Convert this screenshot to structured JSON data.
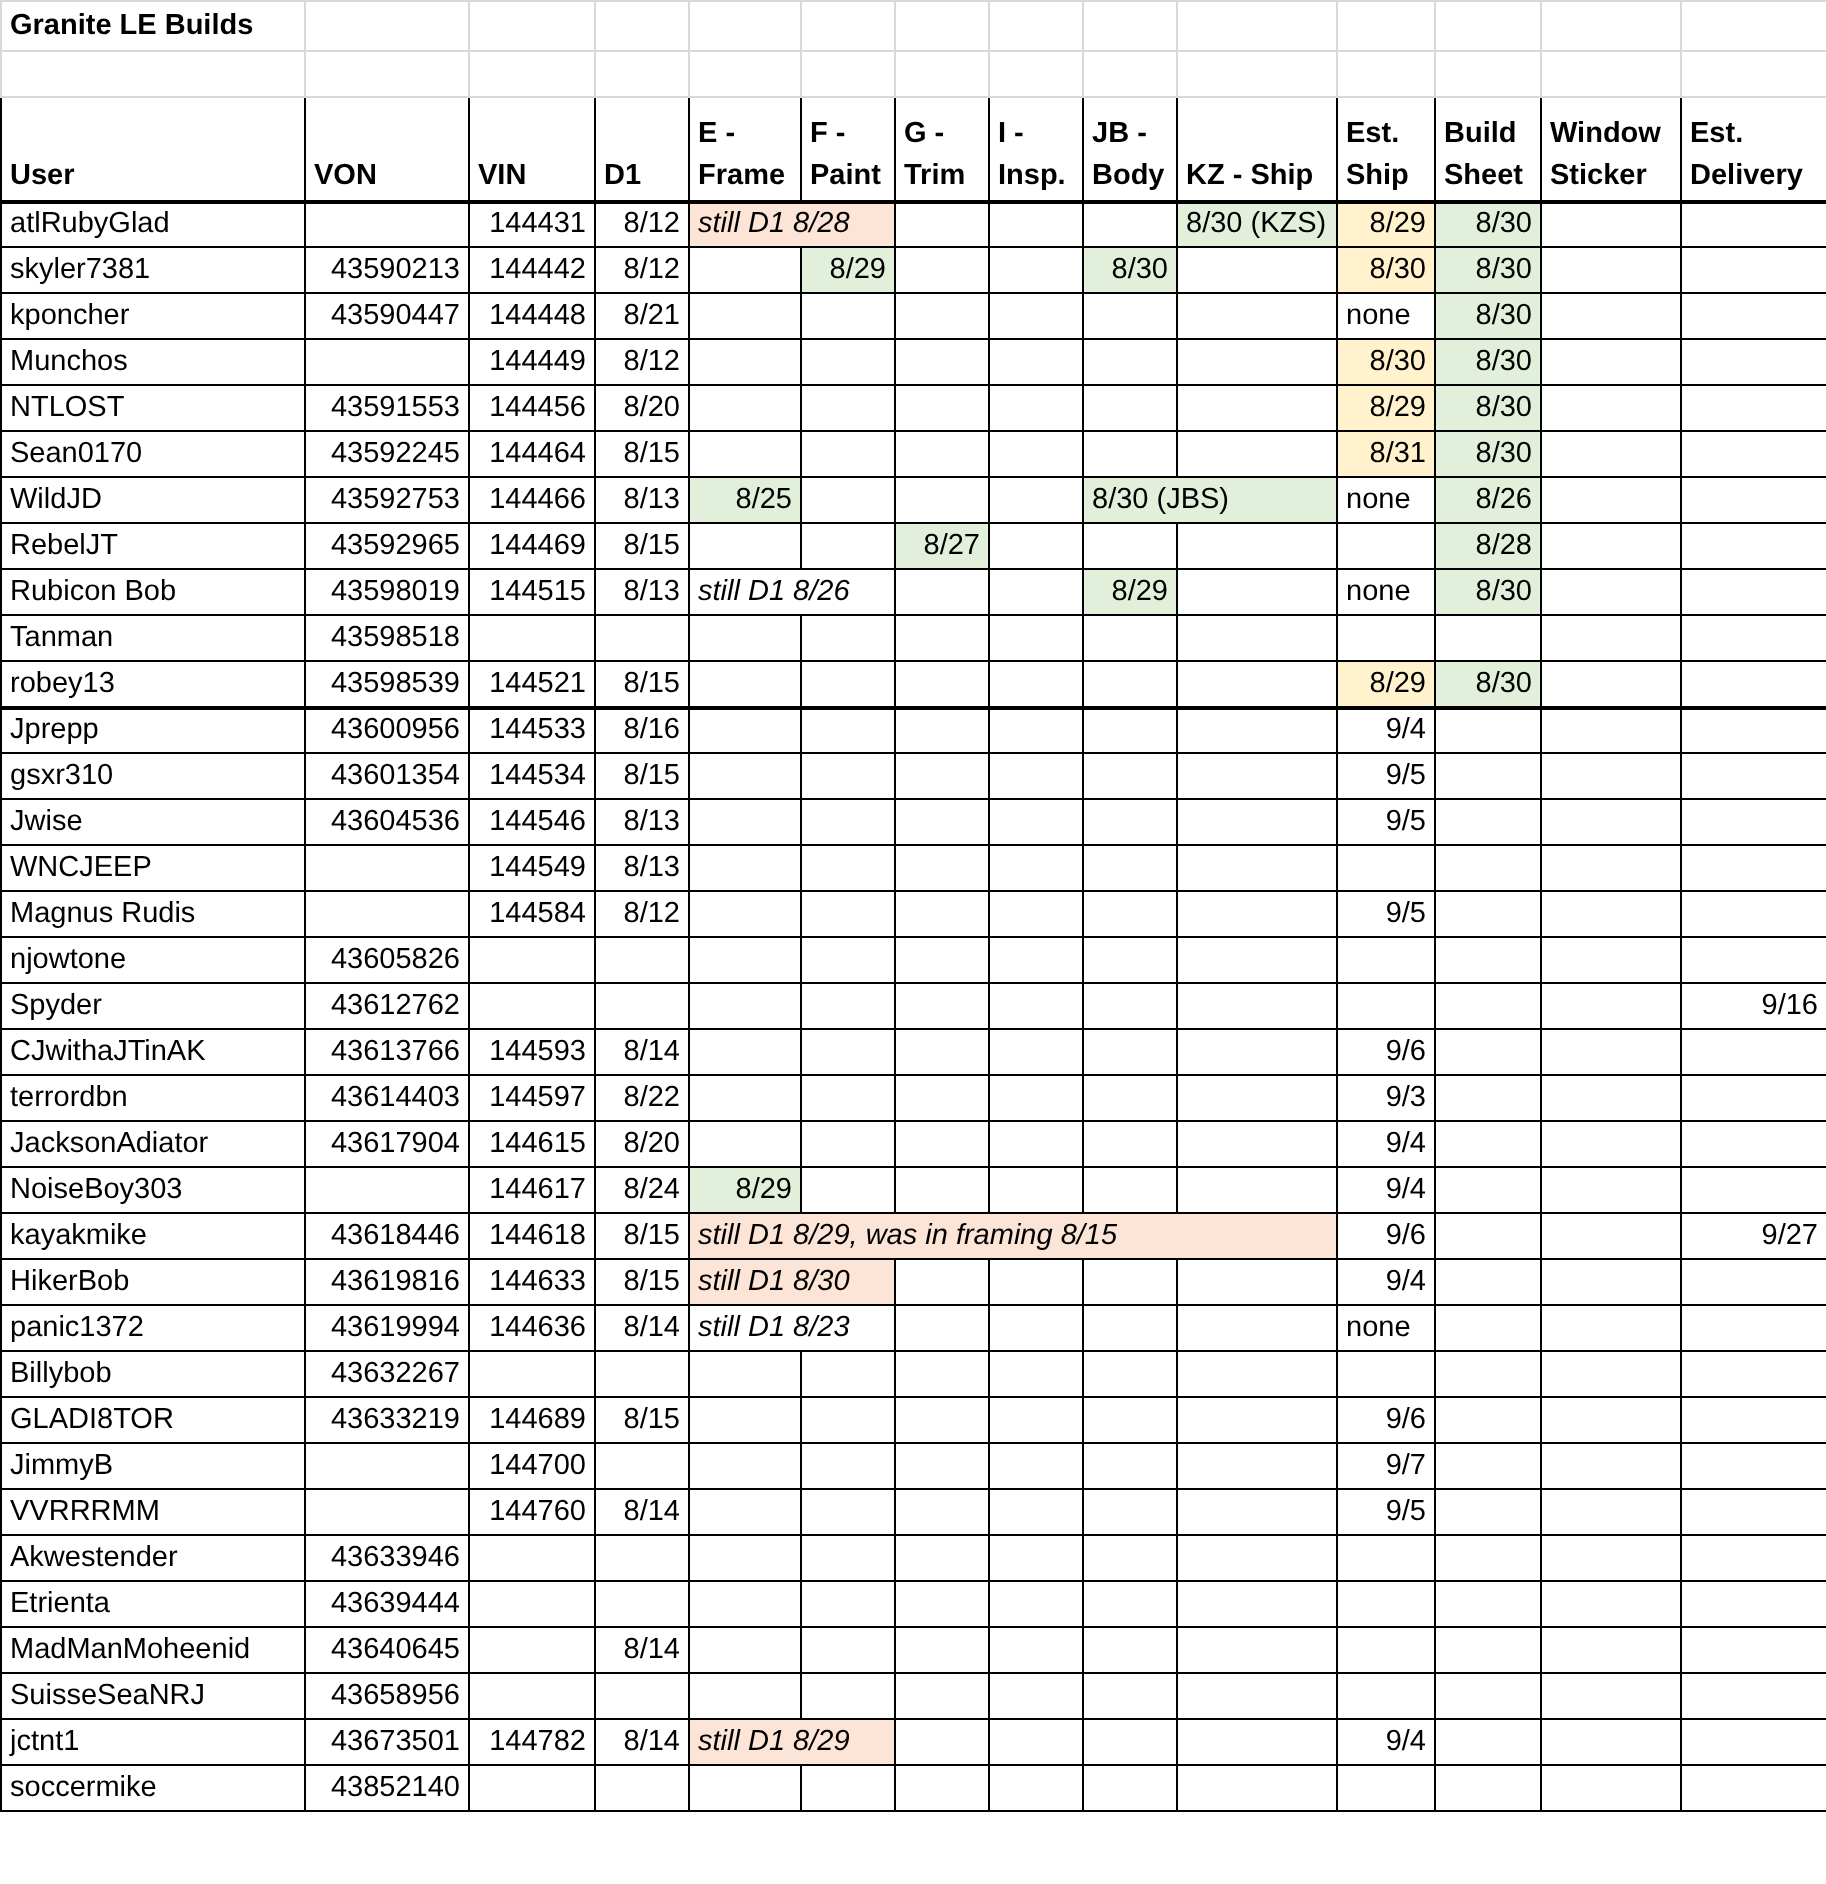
{
  "title": "Granite LE Builds",
  "columns": [
    "User",
    "VON",
    "VIN",
    "D1",
    "E - Frame",
    "F - Paint",
    "G - Trim",
    "I - Insp.",
    "JB - Body",
    "KZ - Ship",
    "Est. Ship",
    "Build Sheet",
    "Window Sticker",
    "Est. Delivery"
  ],
  "rows": [
    {
      "thick_bottom": false,
      "cells": [
        {
          "text": "atlRubyGlad",
          "kind": "text"
        },
        {},
        {
          "text": "144431",
          "kind": "num"
        },
        {
          "text": "8/12",
          "kind": "num"
        },
        {
          "text": "still D1 8/28",
          "kind": "note",
          "color": "#fce4d6"
        },
        {
          "continued": true
        },
        {},
        {},
        {},
        {
          "text": "8/30 (KZS)",
          "kind": "text",
          "color": "#e2efda"
        },
        {
          "text": "8/29",
          "kind": "num",
          "color": "#fff2cc"
        },
        {
          "text": "8/30",
          "kind": "num",
          "color": "#e2efda"
        },
        {},
        {}
      ]
    },
    {
      "thick_bottom": false,
      "cells": [
        {
          "text": "skyler7381",
          "kind": "text"
        },
        {
          "text": "43590213",
          "kind": "num"
        },
        {
          "text": "144442",
          "kind": "num"
        },
        {
          "text": "8/12",
          "kind": "num"
        },
        {},
        {
          "text": "8/29",
          "kind": "num",
          "color": "#e2efda"
        },
        {},
        {},
        {
          "text": "8/30",
          "kind": "num",
          "color": "#e2efda"
        },
        {},
        {
          "text": "8/30",
          "kind": "num",
          "color": "#fff2cc"
        },
        {
          "text": "8/30",
          "kind": "num",
          "color": "#e2efda"
        },
        {},
        {}
      ]
    },
    {
      "thick_bottom": false,
      "cells": [
        {
          "text": "kponcher",
          "kind": "text"
        },
        {
          "text": "43590447",
          "kind": "num"
        },
        {
          "text": "144448",
          "kind": "num"
        },
        {
          "text": "8/21",
          "kind": "num"
        },
        {},
        {},
        {},
        {},
        {},
        {},
        {
          "text": "none",
          "kind": "text"
        },
        {
          "text": "8/30",
          "kind": "num",
          "color": "#e2efda"
        },
        {},
        {}
      ]
    },
    {
      "thick_bottom": false,
      "cells": [
        {
          "text": "Munchos",
          "kind": "text"
        },
        {},
        {
          "text": "144449",
          "kind": "num"
        },
        {
          "text": "8/12",
          "kind": "num"
        },
        {},
        {},
        {},
        {},
        {},
        {},
        {
          "text": "8/30",
          "kind": "num",
          "color": "#fff2cc"
        },
        {
          "text": "8/30",
          "kind": "num",
          "color": "#e2efda"
        },
        {},
        {}
      ]
    },
    {
      "thick_bottom": false,
      "cells": [
        {
          "text": "NTLOST",
          "kind": "text"
        },
        {
          "text": "43591553",
          "kind": "num"
        },
        {
          "text": "144456",
          "kind": "num"
        },
        {
          "text": "8/20",
          "kind": "num"
        },
        {},
        {},
        {},
        {},
        {},
        {},
        {
          "text": "8/29",
          "kind": "num",
          "color": "#fff2cc"
        },
        {
          "text": "8/30",
          "kind": "num",
          "color": "#e2efda"
        },
        {},
        {}
      ]
    },
    {
      "thick_bottom": false,
      "cells": [
        {
          "text": "Sean0170",
          "kind": "text"
        },
        {
          "text": "43592245",
          "kind": "num"
        },
        {
          "text": "144464",
          "kind": "num"
        },
        {
          "text": "8/15",
          "kind": "num"
        },
        {},
        {},
        {},
        {},
        {},
        {},
        {
          "text": "8/31",
          "kind": "num",
          "color": "#fff2cc"
        },
        {
          "text": "8/30",
          "kind": "num",
          "color": "#e2efda"
        },
        {},
        {}
      ]
    },
    {
      "thick_bottom": false,
      "cells": [
        {
          "text": "WildJD",
          "kind": "text"
        },
        {
          "text": "43592753",
          "kind": "num"
        },
        {
          "text": "144466",
          "kind": "num"
        },
        {
          "text": "8/13",
          "kind": "num"
        },
        {
          "text": "8/25",
          "kind": "num",
          "color": "#e2efda"
        },
        {},
        {},
        {},
        {
          "text": "8/30 (JBS)",
          "kind": "text",
          "color": "#e2efda"
        },
        {
          "continued": true
        },
        {
          "text": "none",
          "kind": "text"
        },
        {
          "text": "8/26",
          "kind": "num",
          "color": "#e2efda"
        },
        {},
        {}
      ]
    },
    {
      "thick_bottom": false,
      "cells": [
        {
          "text": "RebelJT",
          "kind": "text"
        },
        {
          "text": "43592965",
          "kind": "num"
        },
        {
          "text": "144469",
          "kind": "num"
        },
        {
          "text": "8/15",
          "kind": "num"
        },
        {},
        {},
        {
          "text": "8/27",
          "kind": "num",
          "color": "#e2efda"
        },
        {},
        {},
        {},
        {},
        {
          "text": "8/28",
          "kind": "num",
          "color": "#e2efda"
        },
        {},
        {}
      ]
    },
    {
      "thick_bottom": false,
      "cells": [
        {
          "text": "Rubicon Bob",
          "kind": "text"
        },
        {
          "text": "43598019",
          "kind": "num"
        },
        {
          "text": "144515",
          "kind": "num"
        },
        {
          "text": "8/13",
          "kind": "num"
        },
        {
          "text": "still D1 8/26",
          "kind": "note"
        },
        {
          "continued": true
        },
        {},
        {},
        {
          "text": "8/29",
          "kind": "num",
          "color": "#e2efda"
        },
        {},
        {
          "text": "none",
          "kind": "text"
        },
        {
          "text": "8/30",
          "kind": "num",
          "color": "#e2efda"
        },
        {},
        {}
      ]
    },
    {
      "thick_bottom": false,
      "cells": [
        {
          "text": "Tanman",
          "kind": "text"
        },
        {
          "text": "43598518",
          "kind": "num"
        },
        {},
        {},
        {},
        {},
        {},
        {},
        {},
        {},
        {},
        {},
        {},
        {}
      ]
    },
    {
      "thick_bottom": true,
      "cells": [
        {
          "text": "robey13",
          "kind": "text"
        },
        {
          "text": "43598539",
          "kind": "num"
        },
        {
          "text": "144521",
          "kind": "num"
        },
        {
          "text": "8/15",
          "kind": "num"
        },
        {},
        {},
        {},
        {},
        {},
        {},
        {
          "text": "8/29",
          "kind": "num",
          "color": "#fff2cc"
        },
        {
          "text": "8/30",
          "kind": "num",
          "color": "#e2efda"
        },
        {},
        {}
      ]
    },
    {
      "thick_bottom": false,
      "cells": [
        {
          "text": "Jprepp",
          "kind": "text"
        },
        {
          "text": "43600956",
          "kind": "num"
        },
        {
          "text": "144533",
          "kind": "num"
        },
        {
          "text": "8/16",
          "kind": "num"
        },
        {},
        {},
        {},
        {},
        {},
        {},
        {
          "text": "9/4",
          "kind": "num"
        },
        {},
        {},
        {}
      ]
    },
    {
      "thick_bottom": false,
      "cells": [
        {
          "text": "gsxr310",
          "kind": "text"
        },
        {
          "text": "43601354",
          "kind": "num"
        },
        {
          "text": "144534",
          "kind": "num"
        },
        {
          "text": "8/15",
          "kind": "num"
        },
        {},
        {},
        {},
        {},
        {},
        {},
        {
          "text": "9/5",
          "kind": "num"
        },
        {},
        {},
        {}
      ]
    },
    {
      "thick_bottom": false,
      "cells": [
        {
          "text": "Jwise",
          "kind": "text"
        },
        {
          "text": "43604536",
          "kind": "num"
        },
        {
          "text": "144546",
          "kind": "num"
        },
        {
          "text": "8/13",
          "kind": "num"
        },
        {},
        {},
        {},
        {},
        {},
        {},
        {
          "text": "9/5",
          "kind": "num"
        },
        {},
        {},
        {}
      ]
    },
    {
      "thick_bottom": false,
      "cells": [
        {
          "text": "WNCJEEP",
          "kind": "text"
        },
        {},
        {
          "text": "144549",
          "kind": "num"
        },
        {
          "text": "8/13",
          "kind": "num"
        },
        {},
        {},
        {},
        {},
        {},
        {},
        {},
        {},
        {},
        {}
      ]
    },
    {
      "thick_bottom": false,
      "cells": [
        {
          "text": "Magnus Rudis",
          "kind": "text"
        },
        {},
        {
          "text": "144584",
          "kind": "num"
        },
        {
          "text": "8/12",
          "kind": "num"
        },
        {},
        {},
        {},
        {},
        {},
        {},
        {
          "text": "9/5",
          "kind": "num"
        },
        {},
        {},
        {}
      ]
    },
    {
      "thick_bottom": false,
      "cells": [
        {
          "text": "njowtone",
          "kind": "text"
        },
        {
          "text": "43605826",
          "kind": "num"
        },
        {},
        {},
        {},
        {},
        {},
        {},
        {},
        {},
        {},
        {},
        {},
        {}
      ]
    },
    {
      "thick_bottom": false,
      "cells": [
        {
          "text": "Spyder",
          "kind": "text"
        },
        {
          "text": "43612762",
          "kind": "num"
        },
        {},
        {},
        {},
        {},
        {},
        {},
        {},
        {},
        {},
        {},
        {},
        {
          "text": "9/16",
          "kind": "num"
        }
      ]
    },
    {
      "thick_bottom": false,
      "cells": [
        {
          "text": "CJwithaJTinAK",
          "kind": "text"
        },
        {
          "text": "43613766",
          "kind": "num"
        },
        {
          "text": "144593",
          "kind": "num"
        },
        {
          "text": "8/14",
          "kind": "num"
        },
        {},
        {},
        {},
        {},
        {},
        {},
        {
          "text": "9/6",
          "kind": "num"
        },
        {},
        {},
        {}
      ]
    },
    {
      "thick_bottom": false,
      "cells": [
        {
          "text": "terrordbn",
          "kind": "text"
        },
        {
          "text": "43614403",
          "kind": "num"
        },
        {
          "text": "144597",
          "kind": "num"
        },
        {
          "text": "8/22",
          "kind": "num"
        },
        {},
        {},
        {},
        {},
        {},
        {},
        {
          "text": "9/3",
          "kind": "num"
        },
        {},
        {},
        {}
      ]
    },
    {
      "thick_bottom": false,
      "cells": [
        {
          "text": "JacksonAdiator",
          "kind": "text"
        },
        {
          "text": "43617904",
          "kind": "num"
        },
        {
          "text": "144615",
          "kind": "num"
        },
        {
          "text": "8/20",
          "kind": "num"
        },
        {},
        {},
        {},
        {},
        {},
        {},
        {
          "text": "9/4",
          "kind": "num"
        },
        {},
        {},
        {}
      ]
    },
    {
      "thick_bottom": false,
      "cells": [
        {
          "text": "NoiseBoy303",
          "kind": "text"
        },
        {},
        {
          "text": "144617",
          "kind": "num"
        },
        {
          "text": "8/24",
          "kind": "num"
        },
        {
          "text": "8/29",
          "kind": "num",
          "color": "#e2efda"
        },
        {},
        {},
        {},
        {},
        {},
        {
          "text": "9/4",
          "kind": "num"
        },
        {},
        {},
        {}
      ]
    },
    {
      "thick_bottom": false,
      "cells": [
        {
          "text": "kayakmike",
          "kind": "text"
        },
        {
          "text": "43618446",
          "kind": "num"
        },
        {
          "text": "144618",
          "kind": "num"
        },
        {
          "text": "8/15",
          "kind": "num"
        },
        {
          "text": "still D1 8/29, was in framing 8/15",
          "kind": "note",
          "color": "#fce4d6"
        },
        {
          "continued": true
        },
        {
          "continued": true
        },
        {
          "continued": true
        },
        {
          "continued": true
        },
        {
          "continued": true
        },
        {
          "text": "9/6",
          "kind": "num"
        },
        {},
        {},
        {
          "text": "9/27",
          "kind": "num"
        }
      ]
    },
    {
      "thick_bottom": false,
      "cells": [
        {
          "text": "HikerBob",
          "kind": "text"
        },
        {
          "text": "43619816",
          "kind": "num"
        },
        {
          "text": "144633",
          "kind": "num"
        },
        {
          "text": "8/15",
          "kind": "num"
        },
        {
          "text": "still D1 8/30",
          "kind": "note",
          "color": "#fce4d6"
        },
        {
          "continued": true
        },
        {},
        {},
        {},
        {},
        {
          "text": "9/4",
          "kind": "num"
        },
        {},
        {},
        {}
      ]
    },
    {
      "thick_bottom": false,
      "cells": [
        {
          "text": "panic1372",
          "kind": "text"
        },
        {
          "text": "43619994",
          "kind": "num"
        },
        {
          "text": "144636",
          "kind": "num"
        },
        {
          "text": "8/14",
          "kind": "num"
        },
        {
          "text": "still D1 8/23",
          "kind": "note"
        },
        {
          "continued": true
        },
        {},
        {},
        {},
        {},
        {
          "text": "none",
          "kind": "text"
        },
        {},
        {},
        {}
      ]
    },
    {
      "thick_bottom": false,
      "cells": [
        {
          "text": "Billybob",
          "kind": "text"
        },
        {
          "text": "43632267",
          "kind": "num"
        },
        {},
        {},
        {},
        {},
        {},
        {},
        {},
        {},
        {},
        {},
        {},
        {}
      ]
    },
    {
      "thick_bottom": false,
      "cells": [
        {
          "text": "GLADI8TOR",
          "kind": "text"
        },
        {
          "text": "43633219",
          "kind": "num"
        },
        {
          "text": "144689",
          "kind": "num"
        },
        {
          "text": "8/15",
          "kind": "num"
        },
        {},
        {},
        {},
        {},
        {},
        {},
        {
          "text": "9/6",
          "kind": "num"
        },
        {},
        {},
        {}
      ]
    },
    {
      "thick_bottom": false,
      "cells": [
        {
          "text": "JimmyB",
          "kind": "text"
        },
        {},
        {
          "text": "144700",
          "kind": "num"
        },
        {},
        {},
        {},
        {},
        {},
        {},
        {},
        {
          "text": "9/7",
          "kind": "num"
        },
        {},
        {},
        {}
      ]
    },
    {
      "thick_bottom": false,
      "cells": [
        {
          "text": "VVRRRMM",
          "kind": "text"
        },
        {},
        {
          "text": "144760",
          "kind": "num"
        },
        {
          "text": "8/14",
          "kind": "num"
        },
        {},
        {},
        {},
        {},
        {},
        {},
        {
          "text": "9/5",
          "kind": "num"
        },
        {},
        {},
        {}
      ]
    },
    {
      "thick_bottom": false,
      "cells": [
        {
          "text": "Akwestender",
          "kind": "text"
        },
        {
          "text": "43633946",
          "kind": "num"
        },
        {},
        {},
        {},
        {},
        {},
        {},
        {},
        {},
        {},
        {},
        {},
        {}
      ]
    },
    {
      "thick_bottom": false,
      "cells": [
        {
          "text": "Etrienta",
          "kind": "text"
        },
        {
          "text": "43639444",
          "kind": "num"
        },
        {},
        {},
        {},
        {},
        {},
        {},
        {},
        {},
        {},
        {},
        {},
        {}
      ]
    },
    {
      "thick_bottom": false,
      "cells": [
        {
          "text": "MadManMoheenid",
          "kind": "text"
        },
        {
          "text": "43640645",
          "kind": "num"
        },
        {},
        {
          "text": "8/14",
          "kind": "num"
        },
        {},
        {},
        {},
        {},
        {},
        {},
        {},
        {},
        {},
        {}
      ]
    },
    {
      "thick_bottom": false,
      "cells": [
        {
          "text": "SuisseSeaNRJ",
          "kind": "text"
        },
        {
          "text": "43658956",
          "kind": "num"
        },
        {},
        {},
        {},
        {},
        {},
        {},
        {},
        {},
        {},
        {},
        {},
        {}
      ]
    },
    {
      "thick_bottom": false,
      "cells": [
        {
          "text": "jctnt1",
          "kind": "text"
        },
        {
          "text": "43673501",
          "kind": "num"
        },
        {
          "text": "144782",
          "kind": "num"
        },
        {
          "text": "8/14",
          "kind": "num"
        },
        {
          "text": "still D1 8/29",
          "kind": "note",
          "color": "#fce4d6"
        },
        {
          "continued": true
        },
        {},
        {},
        {},
        {},
        {
          "text": "9/4",
          "kind": "num"
        },
        {},
        {},
        {}
      ]
    },
    {
      "thick_bottom": false,
      "cells": [
        {
          "text": "soccermike",
          "kind": "text"
        },
        {
          "text": "43852140",
          "kind": "num"
        },
        {},
        {},
        {},
        {},
        {},
        {},
        {},
        {},
        {},
        {},
        {},
        {}
      ]
    }
  ]
}
